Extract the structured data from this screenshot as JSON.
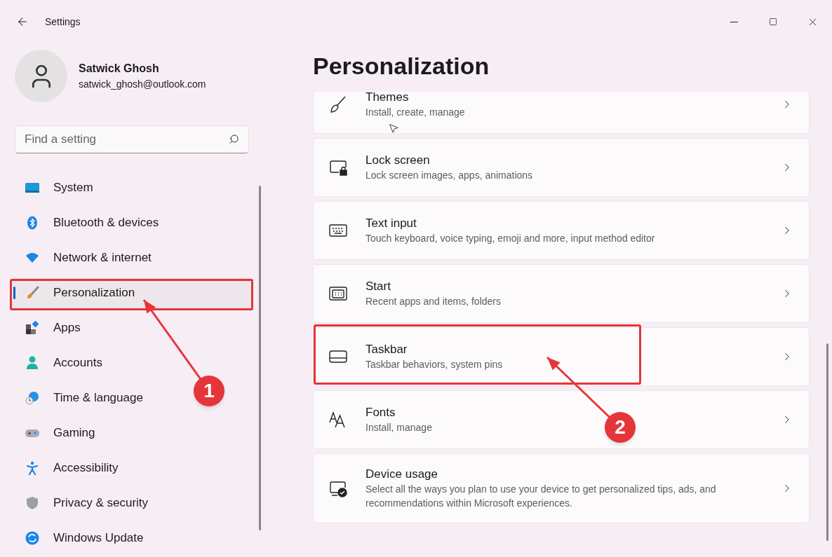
{
  "window": {
    "title": "Settings"
  },
  "profile": {
    "name": "Satwick Ghosh",
    "email": "satwick_ghosh@outlook.com"
  },
  "search": {
    "placeholder": "Find a setting"
  },
  "nav": [
    {
      "label": "System",
      "kind": "system",
      "selected": false
    },
    {
      "label": "Bluetooth & devices",
      "kind": "bluetooth",
      "selected": false
    },
    {
      "label": "Network & internet",
      "kind": "network",
      "selected": false
    },
    {
      "label": "Personalization",
      "kind": "brush",
      "selected": true
    },
    {
      "label": "Apps",
      "kind": "apps",
      "selected": false
    },
    {
      "label": "Accounts",
      "kind": "accounts",
      "selected": false
    },
    {
      "label": "Time & language",
      "kind": "time",
      "selected": false
    },
    {
      "label": "Gaming",
      "kind": "gaming",
      "selected": false
    },
    {
      "label": "Accessibility",
      "kind": "accessibility",
      "selected": false
    },
    {
      "label": "Privacy & security",
      "kind": "privacy",
      "selected": false
    },
    {
      "label": "Windows Update",
      "kind": "update",
      "selected": false
    }
  ],
  "page": {
    "title": "Personalization"
  },
  "cards": [
    {
      "title": "Themes",
      "subtitle": "Install, create, manage",
      "kind": "brush"
    },
    {
      "title": "Lock screen",
      "subtitle": "Lock screen images, apps, animations",
      "kind": "lock"
    },
    {
      "title": "Text input",
      "subtitle": "Touch keyboard, voice typing, emoji and more, input method editor",
      "kind": "keyboard"
    },
    {
      "title": "Start",
      "subtitle": "Recent apps and items, folders",
      "kind": "start"
    },
    {
      "title": "Taskbar",
      "subtitle": "Taskbar behaviors, system pins",
      "kind": "taskbar"
    },
    {
      "title": "Fonts",
      "subtitle": "Install, manage",
      "kind": "fonts"
    },
    {
      "title": "Device usage",
      "subtitle": "Select all the ways you plan to use your device to get personalized tips, ads, and recommendations within Microsoft experiences.",
      "kind": "device"
    }
  ],
  "annotations": [
    {
      "number": "1"
    },
    {
      "number": "2"
    }
  ]
}
